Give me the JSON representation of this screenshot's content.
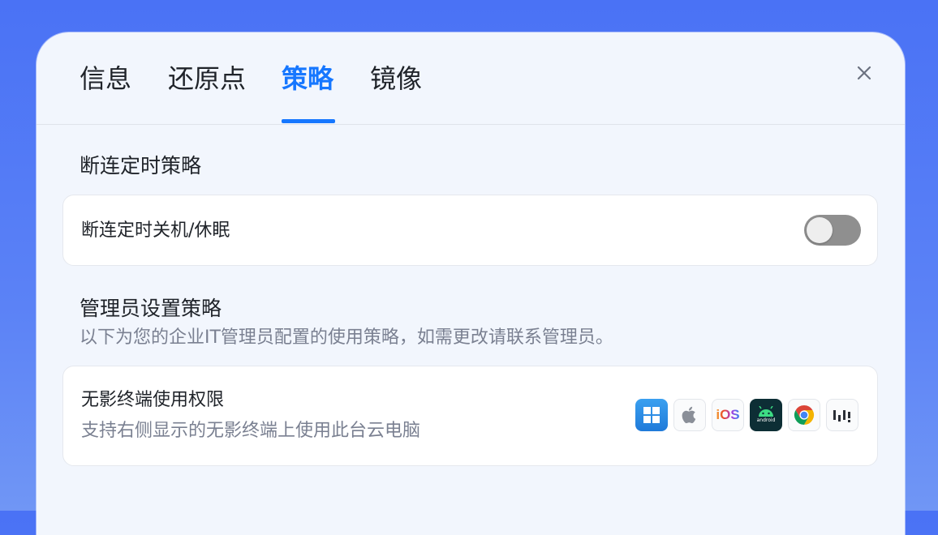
{
  "tabs": [
    {
      "label": "信息",
      "active": false
    },
    {
      "label": "还原点",
      "active": false
    },
    {
      "label": "策略",
      "active": true
    },
    {
      "label": "镜像",
      "active": false
    }
  ],
  "colors": {
    "accent": "#1677ff",
    "background": "#4a72f5",
    "toggle_off": "#8f8f8f"
  },
  "disconnect_section": {
    "title": "断连定时策略",
    "setting": {
      "label": "断连定时关机/休眠",
      "enabled": false
    }
  },
  "admin_section": {
    "title": "管理员设置策略",
    "description": "以下为您的企业IT管理员配置的使用策略，如需更改请联系管理员。",
    "terminal_permission": {
      "title": "无影终端使用权限",
      "subtitle": "支持右侧显示的无影终端上使用此台云电脑",
      "platform_icons": [
        {
          "name": "windows-icon",
          "label": ""
        },
        {
          "name": "apple-icon",
          "label": ""
        },
        {
          "name": "ios-icon",
          "label": "iOS"
        },
        {
          "name": "android-icon",
          "label": "android"
        },
        {
          "name": "chrome-icon",
          "label": ""
        },
        {
          "name": "web-client-icon",
          "label": ""
        }
      ]
    }
  }
}
